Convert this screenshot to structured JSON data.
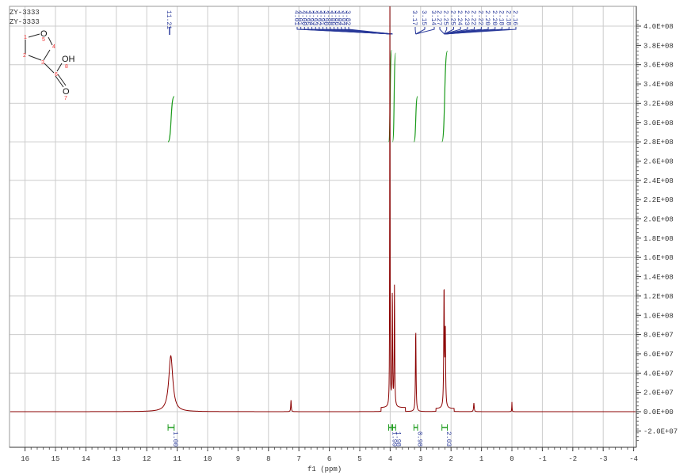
{
  "chart_data": {
    "type": "line",
    "title_lines": [
      "ZY-3333",
      "ZY-3333"
    ],
    "xlabel": "f1 (ppm)",
    "xlim": [
      16,
      -4
    ],
    "xticks": [
      "16",
      "15",
      "14",
      "13",
      "12",
      "11",
      "10",
      "9",
      "8",
      "7",
      "6",
      "5",
      "4",
      "3",
      "2",
      "1",
      "0",
      "-1",
      "-2",
      "-3",
      "-4"
    ],
    "ylim": [
      -35000000.0,
      415000000.0
    ],
    "yticks": [
      "4.0E+08",
      "3.8E+08",
      "3.6E+08",
      "3.4E+08",
      "3.2E+08",
      "3.0E+08",
      "2.8E+08",
      "2.6E+08",
      "2.4E+08",
      "2.2E+08",
      "2.0E+08",
      "1.8E+08",
      "1.6E+08",
      "1.4E+08",
      "1.2E+08",
      "1.0E+08",
      "8.0E+07",
      "6.0E+07",
      "4.0E+07",
      "2.0E+07",
      "0.0E+00",
      "-2.0E+07"
    ],
    "ytick_values": [
      400000000.0,
      380000000.0,
      360000000.0,
      340000000.0,
      320000000.0,
      300000000.0,
      280000000.0,
      260000000.0,
      240000000.0,
      220000000.0,
      200000000.0,
      180000000.0,
      160000000.0,
      140000000.0,
      120000000.0,
      100000000.0,
      80000000.0,
      60000000.0,
      40000000.0,
      20000000.0,
      0,
      -20000000.0
    ],
    "spectrum_color": "#8b0000",
    "peaks": [
      {
        "ppm": 11.21,
        "height": 58000000.0,
        "width": 0.08
      },
      {
        "ppm": 7.26,
        "height": 12000000.0,
        "width": 0.01
      },
      {
        "ppm": 4.01,
        "height": 490000000.0,
        "width": 0.006
      },
      {
        "ppm": 3.93,
        "height": 120000000.0,
        "width": 0.01
      },
      {
        "ppm": 3.86,
        "height": 125000000.0,
        "width": 0.01
      },
      {
        "ppm": 3.16,
        "height": 85000000.0,
        "width": 0.012
      },
      {
        "ppm": 2.23,
        "height": 125000000.0,
        "width": 0.012
      },
      {
        "ppm": 2.19,
        "height": 80000000.0,
        "width": 0.012
      },
      {
        "ppm": 1.25,
        "height": 9000000.0,
        "width": 0.012
      },
      {
        "ppm": 0.0,
        "height": 10000000.0,
        "width": 0.006
      }
    ],
    "peak_groups": [
      {
        "labels": [
          "11.21"
        ],
        "target_ppm": 11.21
      },
      {
        "labels": [
          "4.01",
          "4.01",
          "4.00",
          "3.95",
          "3.94",
          "3.93",
          "3.92",
          "3.91",
          "3.90",
          "3.88",
          "3.86",
          "3.86",
          "3.84",
          "3.84",
          "3.82"
        ],
        "target_ppm": 3.92
      },
      {
        "labels": [
          "3.17",
          "3.15",
          "3.14"
        ],
        "target_ppm": 3.16
      },
      {
        "labels": [
          "2.27",
          "2.25",
          "2.25",
          "2.24",
          "2.23",
          "2.22",
          "2.22",
          "2.20",
          "2.20",
          "2.18",
          "2.18",
          "2.16"
        ],
        "target_ppm": 2.22
      }
    ],
    "integrals": [
      {
        "from": 11.3,
        "to": 11.1,
        "value": "1.00",
        "curve_bottom": 280000000.0,
        "curve_top": 327000000.0
      },
      {
        "from": 4.05,
        "to": 3.95,
        "value": "1.99",
        "curve_bottom": 280000000.0,
        "curve_top": 375000000.0
      },
      {
        "from": 3.92,
        "to": 3.82,
        "value": "1.98",
        "curve_bottom": 280000000.0,
        "curve_top": 372000000.0
      },
      {
        "from": 3.22,
        "to": 3.1,
        "value": "0.98",
        "curve_bottom": 280000000.0,
        "curve_top": 327000000.0
      },
      {
        "from": 2.3,
        "to": 2.12,
        "value": "2.03",
        "curve_bottom": 280000000.0,
        "curve_top": 374000000.0
      }
    ],
    "molecule": {
      "atoms": [
        "O",
        "OH",
        "O"
      ],
      "numbers": [
        "1",
        "2",
        "3",
        "4",
        "5",
        "6",
        "7",
        "8"
      ]
    }
  }
}
